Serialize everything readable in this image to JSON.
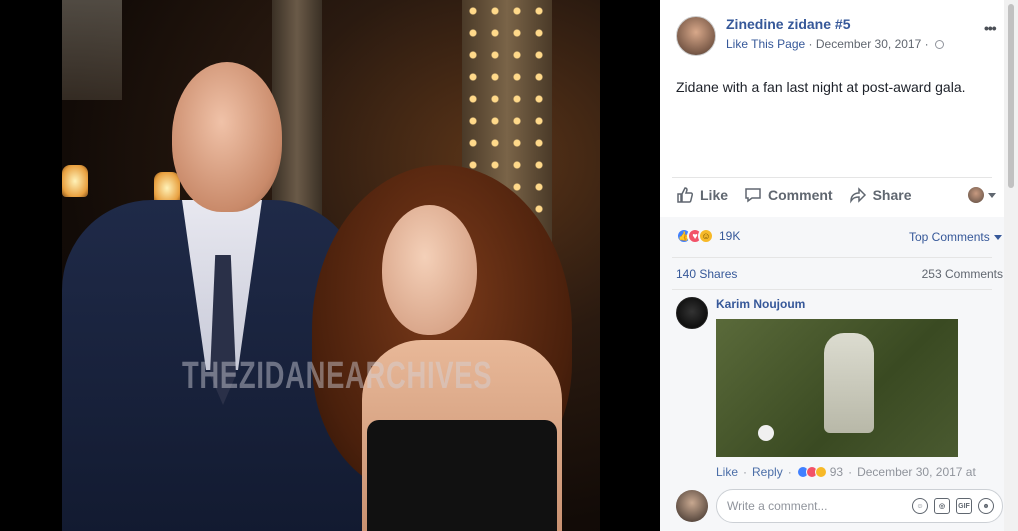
{
  "photo": {
    "watermark": "THEZIDANEARCHIVES"
  },
  "post": {
    "page_name": "Zinedine zidane #5",
    "like_page": "Like This Page",
    "date": "December 30, 2017",
    "separator": "·",
    "text": "Zidane with a fan last night at post-award gala.",
    "more": "•••"
  },
  "actions": {
    "like": "Like",
    "comment": "Comment",
    "share": "Share"
  },
  "feedback": {
    "reaction_count": "19K",
    "top_comments": "Top Comments",
    "shares": "140 Shares",
    "comments": "253 Comments"
  },
  "comment": {
    "author": "Karim Noujoum",
    "like": "Like",
    "reply": "Reply",
    "reactions": "93",
    "date": "December 30, 2017 at"
  },
  "composer": {
    "placeholder": "Write a comment..."
  },
  "colors": {
    "link": "#365899",
    "like_reaction": "#4080ff",
    "love_reaction": "#f25268",
    "haha_reaction": "#f7b928"
  }
}
